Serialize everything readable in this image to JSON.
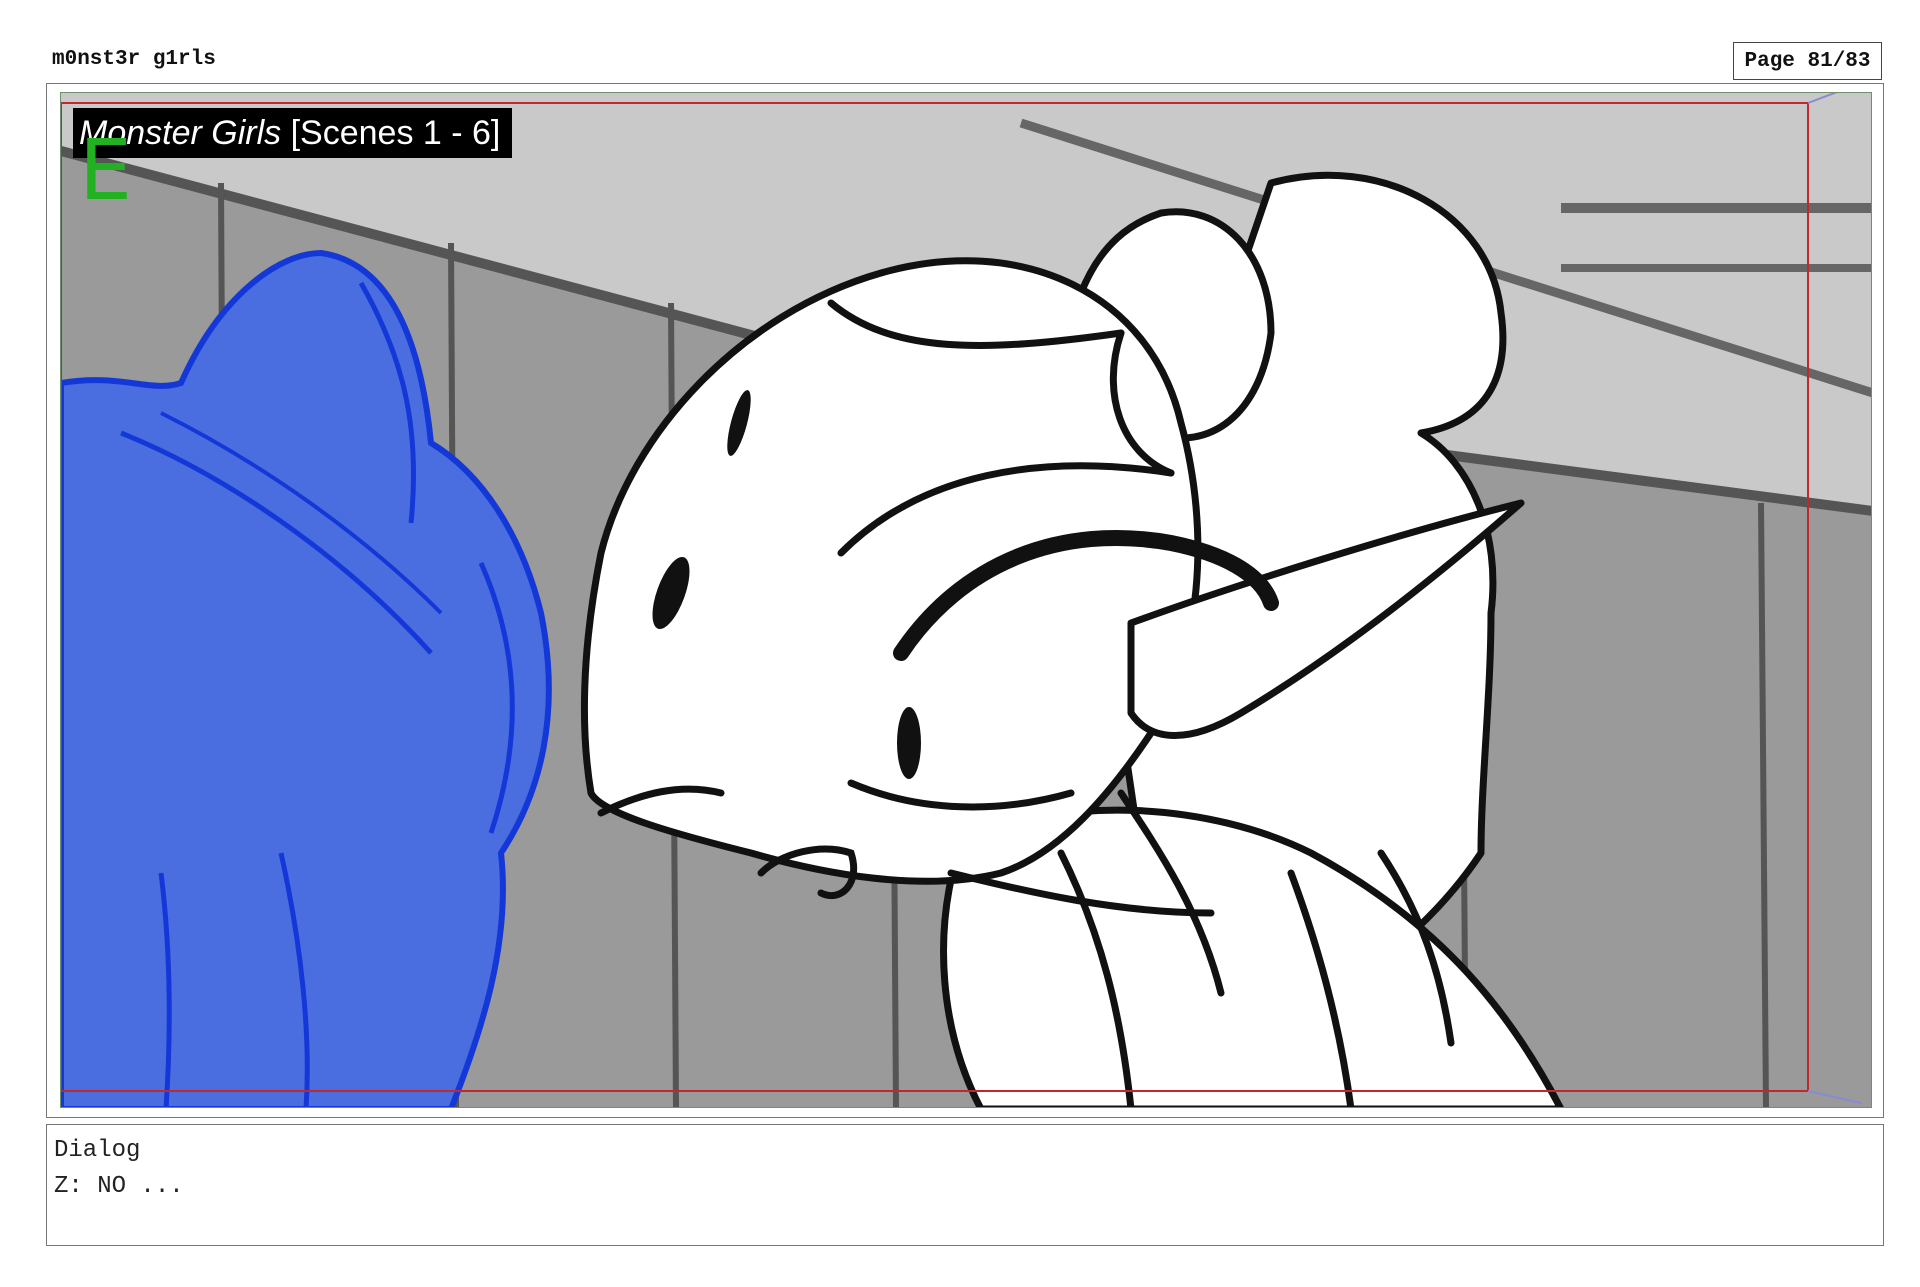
{
  "document": {
    "title": "m0nst3r g1rls",
    "page_label": "Page 81/83"
  },
  "panel": {
    "scene_title_italic": "Monster Girls",
    "scene_title_rest": " [Scenes 1 - 6]",
    "panel_letter": "E",
    "colors": {
      "wall": "#9a9a9a",
      "ceiling": "#c9c9c9",
      "ink": "#111111",
      "blue_character": "#4a6ee0",
      "blue_line": "#1438d8",
      "safe_frame": "#c0282d",
      "panel_letter": "#22b122"
    }
  },
  "dialog": {
    "heading": "Dialog",
    "line": "Z: NO ..."
  }
}
